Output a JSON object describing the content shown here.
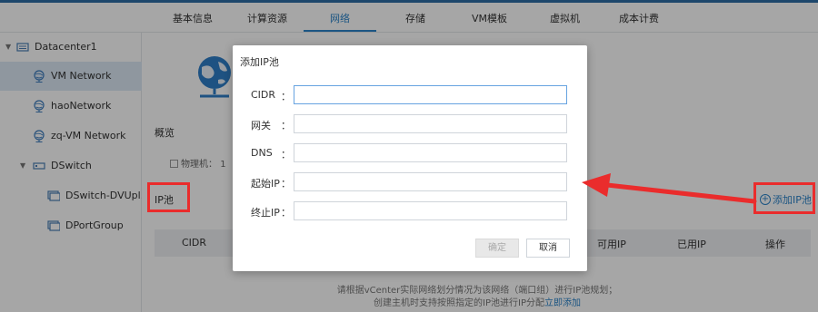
{
  "tabs": [
    {
      "label": "基本信息"
    },
    {
      "label": "计算资源"
    },
    {
      "label": "网络"
    },
    {
      "label": "存储"
    },
    {
      "label": "VM模板"
    },
    {
      "label": "虚拟机"
    },
    {
      "label": "成本计费"
    }
  ],
  "sidebar": {
    "items": [
      {
        "label": "Datacenter1",
        "icon": "datacenter-icon"
      },
      {
        "label": "VM Network",
        "icon": "network-icon"
      },
      {
        "label": "haoNetwork",
        "icon": "network-icon"
      },
      {
        "label": "zq-VM Network",
        "icon": "network-icon"
      },
      {
        "label": "DSwitch",
        "icon": "switch-icon"
      },
      {
        "label": "DSwitch-DVUpl...",
        "icon": "portgroup-icon"
      },
      {
        "label": "DPortGroup",
        "icon": "portgroup-icon"
      }
    ]
  },
  "main": {
    "overview_label": "概览",
    "host_label": "物理机：",
    "host_value": "1",
    "ippool_label": "IP池",
    "add_ippool_label": "添加IP池",
    "table_headers": [
      "CIDR",
      "可用IP",
      "已用IP",
      "操作"
    ],
    "empty_line1": "请根据vCenter实际网络划分情况为该网络（端口组）进行IP池规划；",
    "empty_line2": "创建主机时支持按照指定的IP池进行IP分配",
    "empty_link": "立即添加"
  },
  "dialog": {
    "title": "添加IP池",
    "fields": [
      {
        "label": "CIDR",
        "value": "",
        "placeholder": ""
      },
      {
        "label": "网关",
        "value": "",
        "placeholder": ""
      },
      {
        "label": "DNS",
        "value": "",
        "placeholder": ""
      },
      {
        "label": "起始IP",
        "value": "",
        "placeholder": ""
      },
      {
        "label": "终止IP",
        "value": "",
        "placeholder": ""
      }
    ],
    "colon": "：",
    "ok_label": "确定",
    "cancel_label": "取消"
  },
  "colors": {
    "accent": "#2b83c9",
    "highlight": "#ea2c2c",
    "selected_row": "#dce8f4"
  }
}
